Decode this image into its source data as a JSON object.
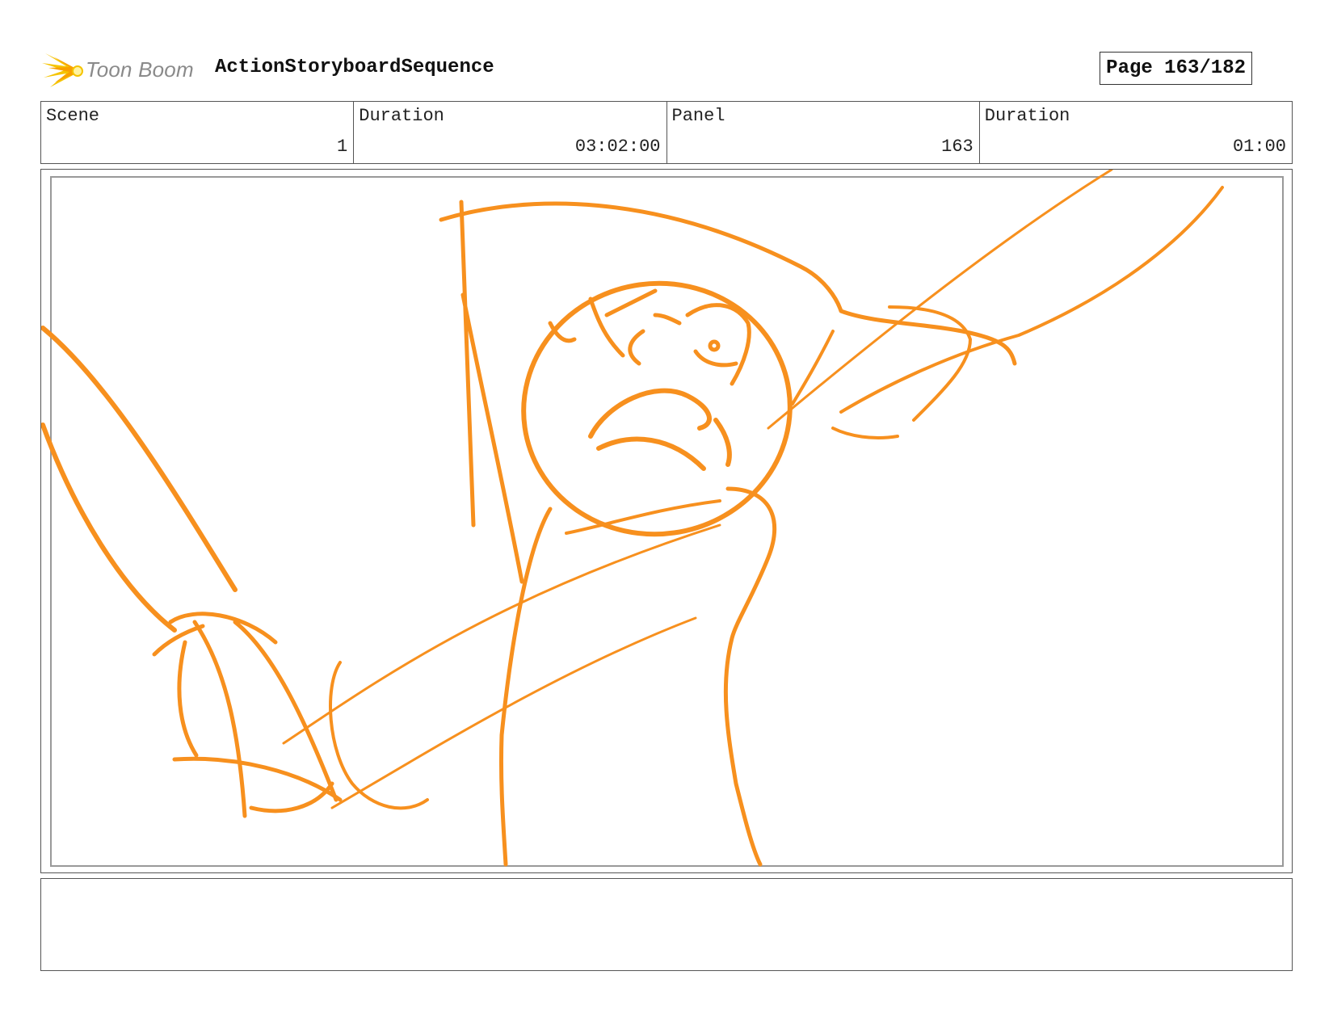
{
  "header": {
    "logo_text": "Toon Boom",
    "sequence_title": "ActionStoryboardSequence",
    "page_label": "Page 163/182"
  },
  "info": {
    "scene_label": "Scene",
    "scene_value": "1",
    "scene_duration_label": "Duration",
    "scene_duration_value": "03:02:00",
    "panel_label": "Panel",
    "panel_value": "163",
    "panel_duration_label": "Duration",
    "panel_duration_value": "01:00"
  },
  "colors": {
    "sketch_stroke": "#f7901e",
    "logo_yellow": "#f5c400"
  },
  "notes": {
    "text": ""
  }
}
